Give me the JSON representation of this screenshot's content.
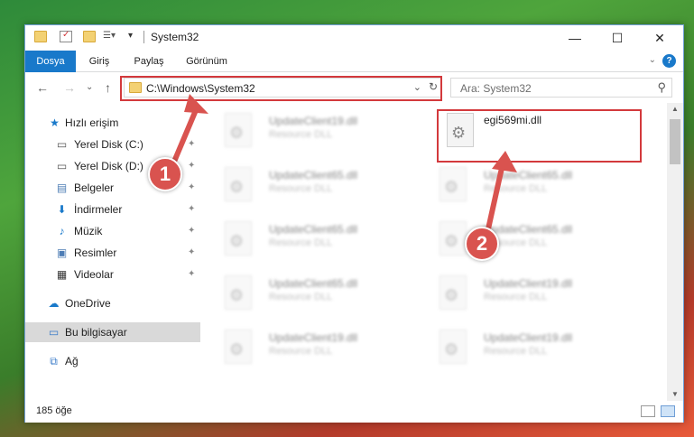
{
  "window": {
    "title": "System32",
    "minimize": "—",
    "maximize": "☐",
    "close": "✕"
  },
  "ribbon": {
    "tabs": [
      {
        "label": "Dosya",
        "active": true
      },
      {
        "label": "Giriş"
      },
      {
        "label": "Paylaş"
      },
      {
        "label": "Görünüm"
      }
    ],
    "collapse": "⌄",
    "help": "?"
  },
  "address": {
    "back": "←",
    "forward": "→",
    "recent": "⌄",
    "up": "↑",
    "path": "C:\\Windows\\System32",
    "dropdown": "⌄",
    "refresh": "↻"
  },
  "search": {
    "placeholder": "Ara: System32",
    "icon": "search-icon"
  },
  "navpane": {
    "items": [
      {
        "label": "Hızlı erişim",
        "icon": "star-icon"
      },
      {
        "label": "Yerel Disk (C:)",
        "icon": "drive-icon",
        "pinned": true
      },
      {
        "label": "Yerel Disk (D:)",
        "icon": "drive-icon",
        "pinned": true
      },
      {
        "label": "Belgeler",
        "icon": "document-icon",
        "pinned": true
      },
      {
        "label": "İndirmeler",
        "icon": "download-icon",
        "pinned": true
      },
      {
        "label": "Müzik",
        "icon": "music-icon",
        "pinned": true
      },
      {
        "label": "Resimler",
        "icon": "picture-icon",
        "pinned": true
      },
      {
        "label": "Videolar",
        "icon": "video-icon",
        "pinned": true
      },
      {
        "label": "OneDrive",
        "icon": "cloud-icon"
      },
      {
        "label": "Bu bilgisayar",
        "icon": "computer-icon",
        "selected": true
      },
      {
        "label": "Ağ",
        "icon": "network-icon"
      }
    ],
    "pin_glyph": "📌"
  },
  "files": [
    {
      "name": "UpdateClient19.dll",
      "desc": "Resource DLL"
    },
    {
      "name": "egi569mi.dll",
      "desc": ""
    },
    {
      "name": "UpdateClient65.dll",
      "desc": "Resource DLL"
    },
    {
      "name": "UpdateClient65.dll",
      "desc": "Resource DLL"
    },
    {
      "name": "UpdateClient65.dll",
      "desc": "Resource DLL"
    },
    {
      "name": "UpdateClient65.dll",
      "desc": "Resource DLL"
    },
    {
      "name": "UpdateClient65.dll",
      "desc": "Resource DLL"
    },
    {
      "name": "UpdateClient19.dll",
      "desc": "Resource DLL"
    },
    {
      "name": "UpdateClient19.dll",
      "desc": "Resource DLL"
    },
    {
      "name": "UpdateClient19.dll",
      "desc": "Resource DLL"
    }
  ],
  "status": {
    "count": "185 öğe"
  },
  "annotations": {
    "badge1": "1",
    "badge2": "2"
  },
  "colors": {
    "accent": "#1979ca",
    "annotation": "#d3393c"
  }
}
